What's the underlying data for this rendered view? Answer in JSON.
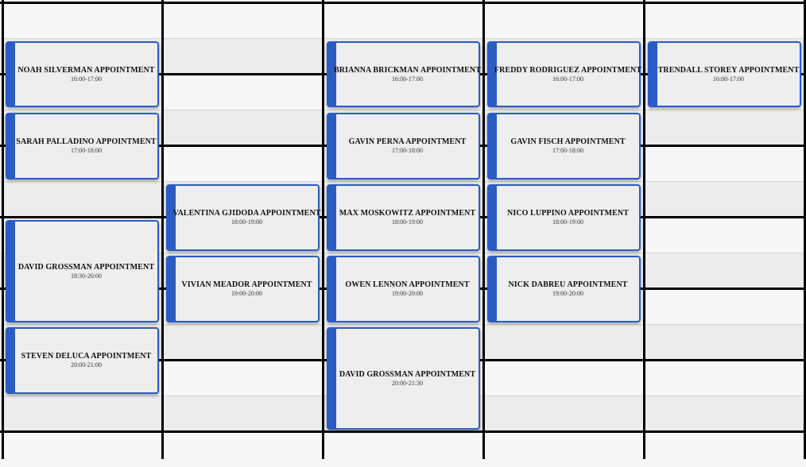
{
  "calendar": {
    "appointments": [
      {
        "title": "NOAH SILVERMAN APPOINTMENT",
        "time": "16:00-17:00"
      },
      {
        "title": "SARAH PALLADINO APPOINTMENT",
        "time": "17:00-18:00"
      },
      {
        "title": "DAVID GROSSMAN APPOINTMENT",
        "time": "18:30-20:00"
      },
      {
        "title": "STEVEN DELUCA APPOINTMENT",
        "time": "20:00-21:00"
      },
      {
        "title": "VALENTINA GJIDODA APPOINTMENT",
        "time": "18:00-19:00"
      },
      {
        "title": "VIVIAN MEADOR APPOINTMENT",
        "time": "19:00-20:00"
      },
      {
        "title": "BRIANNA BRICKMAN APPOINTMENT",
        "time": "16:00-17:00"
      },
      {
        "title": "GAVIN PERNA APPOINTMENT",
        "time": "17:00-18:00"
      },
      {
        "title": "MAX MOSKOWITZ APPOINTMENT",
        "time": "18:00-19:00"
      },
      {
        "title": "OWEN LENNON APPOINTMENT",
        "time": "19:00-20:00"
      },
      {
        "title": "DAVID GROSSMAN APPOINTMENT",
        "time": "20:00-21:30"
      },
      {
        "title": "FREDDY RODRIGUEZ APPOINTMENT",
        "time": "16:00-17:00"
      },
      {
        "title": "GAVIN FISCH APPOINTMENT",
        "time": "17:00-18:00"
      },
      {
        "title": "NICO LUPPINO APPOINTMENT",
        "time": "18:00-19:00"
      },
      {
        "title": "NICK DABREU APPOINTMENT",
        "time": "19:00-20:00"
      },
      {
        "title": "TRENDALL STOREY APPOINTMENT",
        "time": "16:00-17:00"
      }
    ]
  },
  "colors": {
    "accent": "#2a5cc4",
    "card_background": "#eeeeee",
    "grid_line": "#000000",
    "row_shade": "#ececec"
  }
}
